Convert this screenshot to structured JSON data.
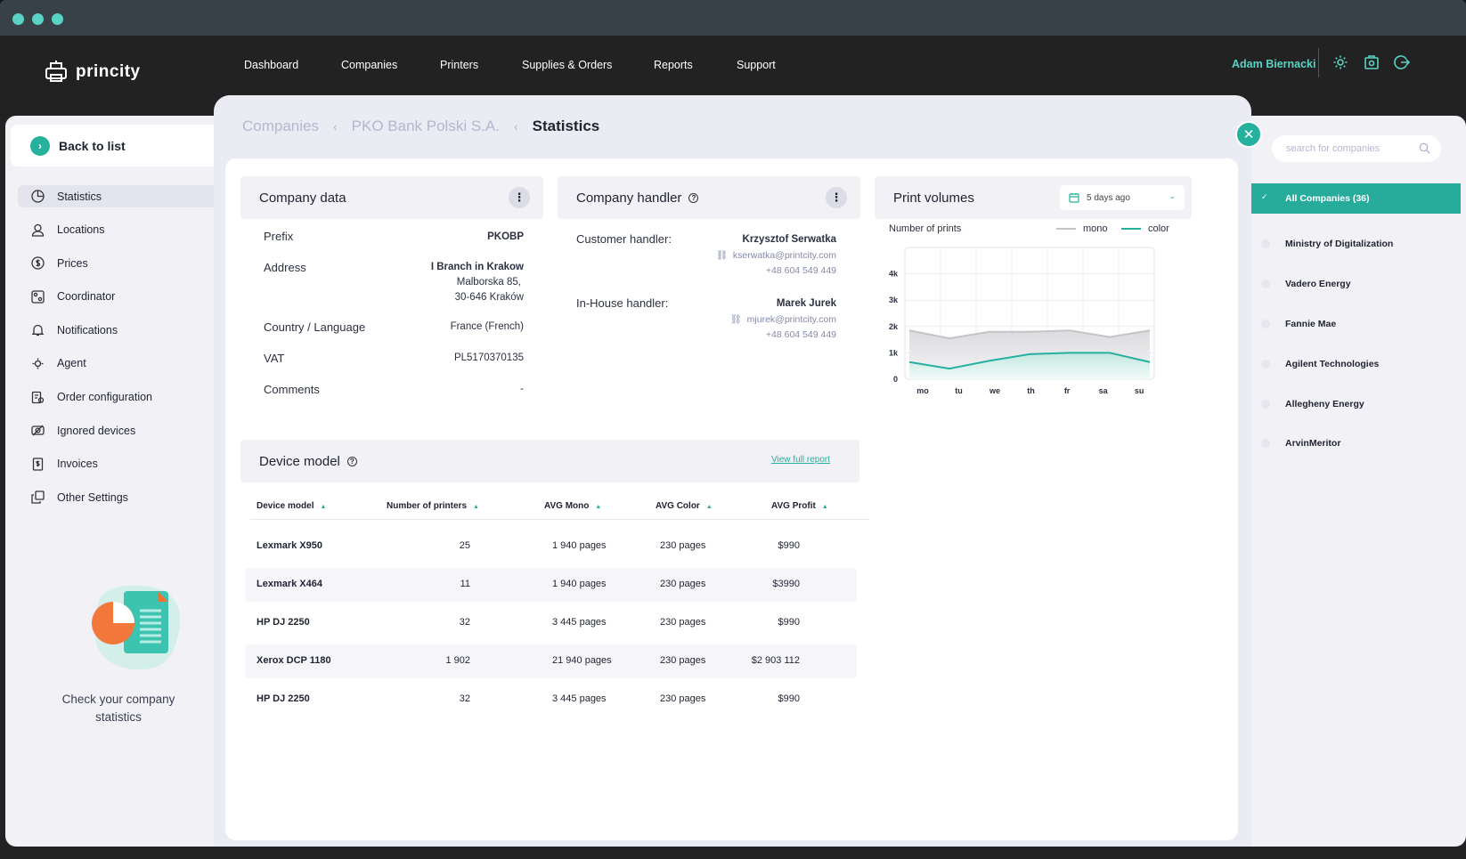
{
  "topnav": {
    "logo": "princity",
    "items": [
      {
        "label": "Dashboard"
      },
      {
        "label": "Companies"
      },
      {
        "label": "Printers"
      },
      {
        "label": "Supplies & Orders"
      },
      {
        "label": "Reports"
      },
      {
        "label": "Support"
      }
    ],
    "active_index": 1,
    "user": "Adam Biernacki",
    "icons": [
      "gear-icon",
      "camera-icon",
      "logout-icon"
    ]
  },
  "sidebar": {
    "back_label": "Back to list",
    "items": [
      {
        "label": "Statistics",
        "icon": "pie-chart-icon"
      },
      {
        "label": "Locations",
        "icon": "user-icon"
      },
      {
        "label": "Prices",
        "icon": "dollar-icon"
      },
      {
        "label": "Coordinator",
        "icon": "coordinator-icon"
      },
      {
        "label": "Notifications",
        "icon": "bell-icon"
      },
      {
        "label": "Agent",
        "icon": "agent-icon"
      },
      {
        "label": "Order configuration",
        "icon": "order-config-icon"
      },
      {
        "label": "Ignored devices",
        "icon": "ignored-icon"
      },
      {
        "label": "Invoices",
        "icon": "invoice-icon"
      },
      {
        "label": "Other Settings",
        "icon": "settings-copy-icon"
      }
    ],
    "active_index": 0,
    "promo_text": "Check your company statistics"
  },
  "breadcrumb": {
    "items": [
      "Companies",
      "PKO Bank Polski S.A."
    ],
    "current": "Statistics"
  },
  "company_data": {
    "title": "Company data",
    "rows": [
      {
        "label": "Prefix",
        "value": "PKOBP"
      },
      {
        "label": "Address",
        "value_lines": [
          "I Branch in Krakow",
          "Malborska 85,",
          "30-646 Kraków"
        ]
      },
      {
        "label": "Country / Language",
        "value": "France (French)"
      },
      {
        "label": "VAT",
        "value": "PL5170370135"
      },
      {
        "label": "Comments",
        "value": "-"
      }
    ]
  },
  "company_handler": {
    "title": "Company handler",
    "customer": {
      "label": "Customer handler:",
      "name": "Krzysztof Serwatka",
      "email": "kserwatka@printcity.com",
      "phone": "+48 604 549 449"
    },
    "inhouse": {
      "label": "In-House handler:",
      "name": "Marek Jurek",
      "email": "mjurek@printcity.com",
      "phone": "+48 604 549 449"
    }
  },
  "print_volumes": {
    "title": "Print volumes",
    "range": "5 days ago",
    "subtitle": "Number of prints",
    "legend": {
      "mono": "mono",
      "color": "color"
    }
  },
  "chart_data": {
    "type": "area",
    "x": [
      "mo",
      "tu",
      "we",
      "th",
      "fr",
      "sa",
      "su"
    ],
    "ylim": [
      0,
      5000
    ],
    "yticks": [
      "0",
      "1k",
      "2k",
      "3k",
      "4k"
    ],
    "ytick_values": [
      0,
      1000,
      2000,
      3000,
      4000
    ],
    "series": [
      {
        "name": "mono",
        "color": "#c4c4c8",
        "values": [
          1850,
          1550,
          1800,
          1800,
          1850,
          1600,
          1850
        ]
      },
      {
        "name": "color",
        "color": "#26b19f",
        "values": [
          650,
          400,
          700,
          950,
          1000,
          1000,
          650
        ]
      }
    ],
    "grid": true
  },
  "device_model": {
    "title": "Device model",
    "link": "View full report",
    "columns": [
      "Device model",
      "Number of printers",
      "AVG Mono",
      "AVG Color",
      "AVG Profit"
    ],
    "rows": [
      [
        "Lexmark X950",
        "25",
        "1 940 pages",
        "230 pages",
        "$990"
      ],
      [
        "Lexmark X464",
        "11",
        "1 940 pages",
        "230 pages",
        "$3990"
      ],
      [
        "HP DJ 2250",
        "32",
        "3 445 pages",
        "230 pages",
        "$990"
      ],
      [
        "Xerox DCP 1180",
        "1 902",
        "21 940 pages",
        "230 pages",
        "$2 903 112"
      ],
      [
        "HP DJ 2250",
        "32",
        "3 445 pages",
        "230 pages",
        "$990"
      ]
    ]
  },
  "companies_panel": {
    "search_placeholder": "search for companies",
    "items": [
      "All Companies (36)",
      "Ministry of Digitalization",
      "Vadero Energy",
      "Fannie Mae",
      "Agilent Technologies",
      "Allegheny Energy",
      "ArvinMeritor"
    ],
    "active_index": 0
  },
  "colors": {
    "accent": "#26b19f",
    "dark": "#222222",
    "panel": "#ebebf3"
  }
}
